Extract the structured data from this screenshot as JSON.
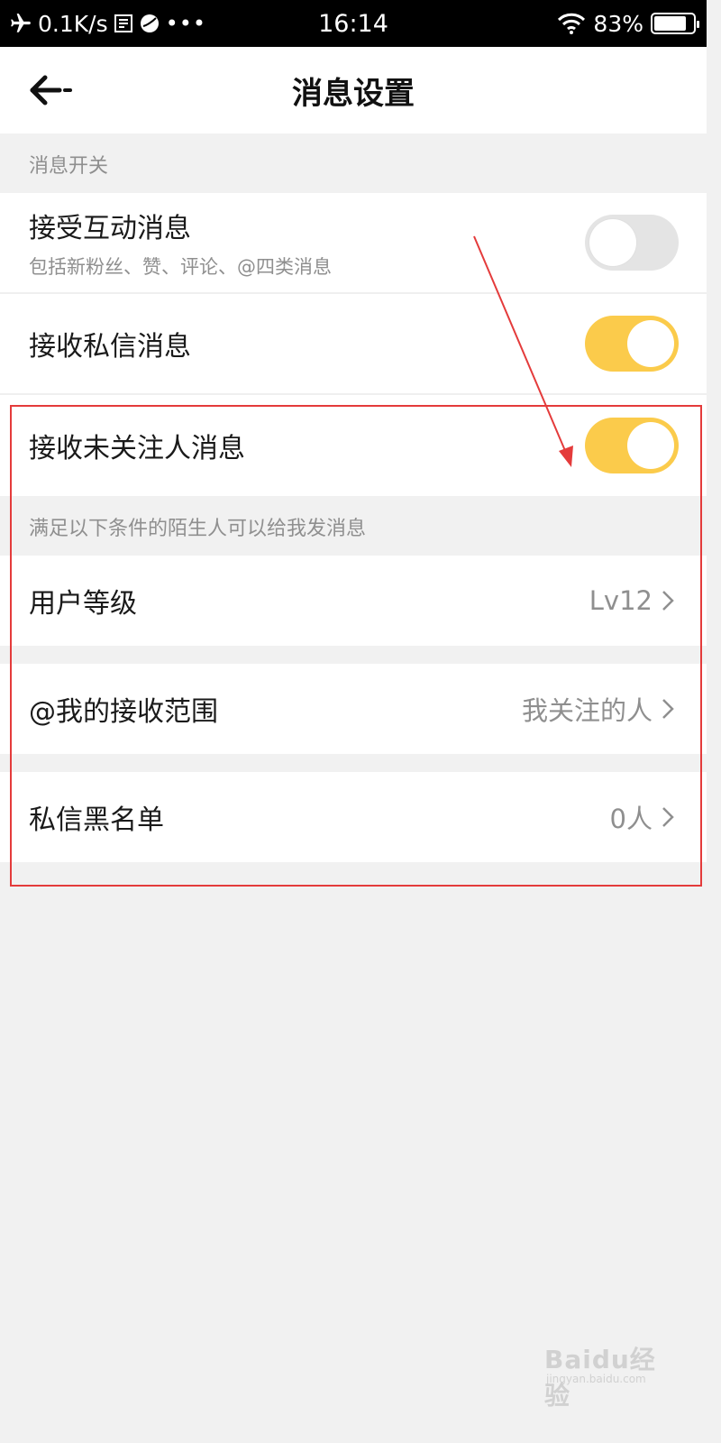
{
  "status_bar": {
    "speed": "0.1K/s",
    "time": "16:14",
    "battery": "83%",
    "battery_level": 0.83,
    "icons": [
      "airplane-icon",
      "notification-icon",
      "app-icon",
      "more-icon",
      "wifi-icon",
      "battery-icon"
    ]
  },
  "header": {
    "title": "消息设置",
    "back_icon": "back-arrow-icon"
  },
  "sections": {
    "switch_label": "消息开关",
    "stranger_label": "满足以下条件的陌生人可以给我发消息"
  },
  "rows": {
    "interaction": {
      "title": "接受互动消息",
      "subtitle": "包括新粉丝、赞、评论、@四类消息",
      "toggle_on": false
    },
    "private_message": {
      "title": "接收私信消息",
      "toggle_on": true
    },
    "stranger_message": {
      "title": "接收未关注人消息",
      "toggle_on": true
    },
    "user_level": {
      "title": "用户等级",
      "value": "Lv12"
    },
    "mention_scope": {
      "title": "@我的接收范围",
      "value": "我关注的人"
    },
    "blacklist": {
      "title": "私信黑名单",
      "value": "0人"
    }
  },
  "colors": {
    "toggle_on": "#fbcb4b",
    "toggle_off": "#e4e4e4",
    "annotation": "#e43b3b"
  },
  "watermark": {
    "text": "Baidu经验",
    "sub": "jingyan.baidu.com"
  }
}
